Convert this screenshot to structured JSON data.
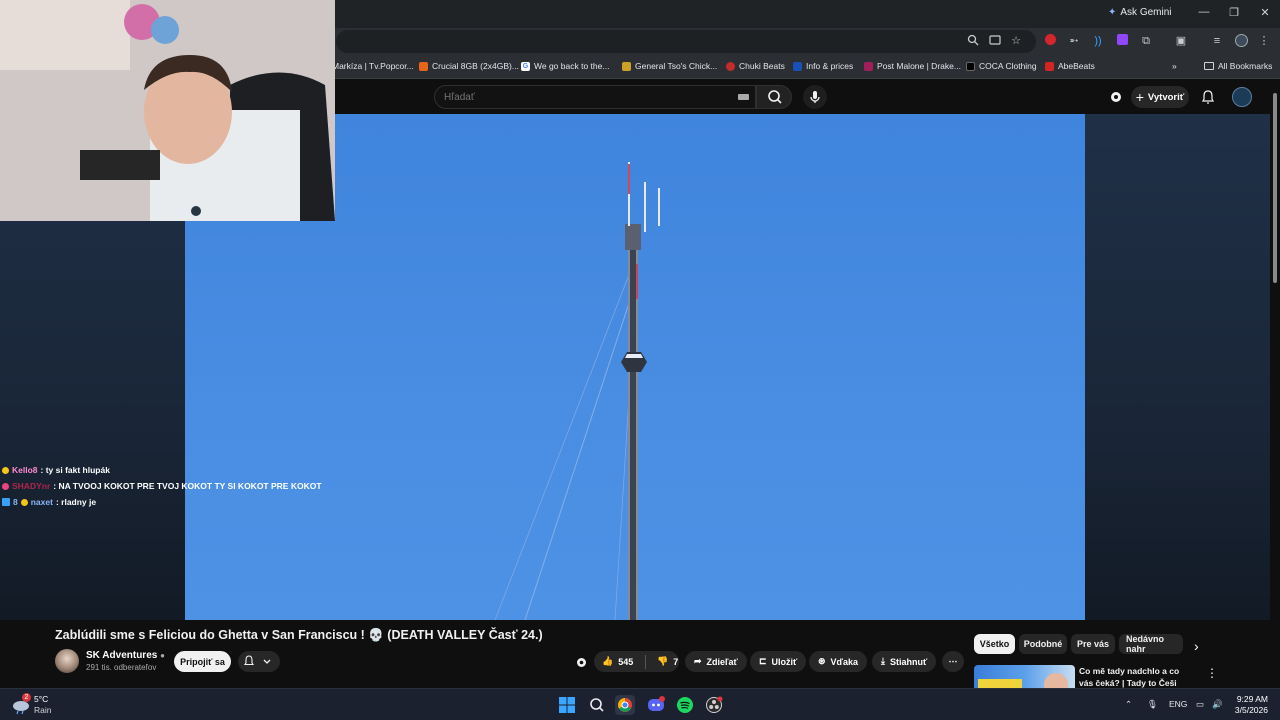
{
  "browser": {
    "ask_gemini": "Ask Gemini",
    "bookmarks": [
      {
        "label": "Markíza | Tv.Popcor...",
        "color": "#2b2f33"
      },
      {
        "label": "Crucial 8GB (2x4GB)...",
        "color": "#e8641b"
      },
      {
        "label": "We go back to the...",
        "color": "#4285f4"
      },
      {
        "label": "General Tso's Chick...",
        "color": "#c9a227"
      },
      {
        "label": "Chuki Beats",
        "color": "#c42b2b"
      },
      {
        "label": "Info & prices",
        "color": "#1a4fb8"
      },
      {
        "label": "Post Malone | Drake...",
        "color": "#a01e5a"
      },
      {
        "label": "COCA Clothing",
        "color": "#111111"
      },
      {
        "label": "AbeBeats",
        "color": "#d52424"
      }
    ],
    "all_bookmarks": "All Bookmarks"
  },
  "youtube": {
    "search_placeholder": "Hľadať",
    "create_label": "Vytvoriť"
  },
  "chat": [
    {
      "user": "Kello8",
      "message": ": ty si fakt hlupák",
      "user_color": "#ff8bd0",
      "badge_color": "#f5c518"
    },
    {
      "user": "SHADYnr",
      "message": ": NA TVOOJ KOKOT PRE TVOJ KOKOT TY SI KOKOT PRE KOKOT",
      "user_color": "#b0254a",
      "badge_color": "#e8467c"
    },
    {
      "user": "naxet",
      "message": ": rladny je",
      "prefix": "8",
      "user_color": "#8ab4f8",
      "badge_color": "#f5c518"
    }
  ],
  "video": {
    "title": "Zablúdili sme s Feliciou do Ghetta v San Franciscu ! 💀 (DEATH VALLEY Časť 24.)",
    "channel": "SK Adventures",
    "subscribers": "291 tis. odberateľov",
    "join_label": "Pripojiť sa",
    "likes": "545",
    "dislikes": "7",
    "share_label": "Zdieľať",
    "save_label": "Uložiť",
    "thanks_label": "Vďaka",
    "download_label": "Stiahnuť"
  },
  "filter_chips": [
    "Všetko",
    "Podobné",
    "Pre vás",
    "Nedávno nahr"
  ],
  "recommendation": {
    "title": "Co mě tady nadchlo a co vás čeká? | Tady to Češi zatím ..."
  },
  "taskbar": {
    "weather_temp": "5°C",
    "weather_desc": "Rain",
    "weather_badge": "2",
    "lang": "ENG",
    "time": "9:29 AM",
    "date": "3/5/2026"
  }
}
